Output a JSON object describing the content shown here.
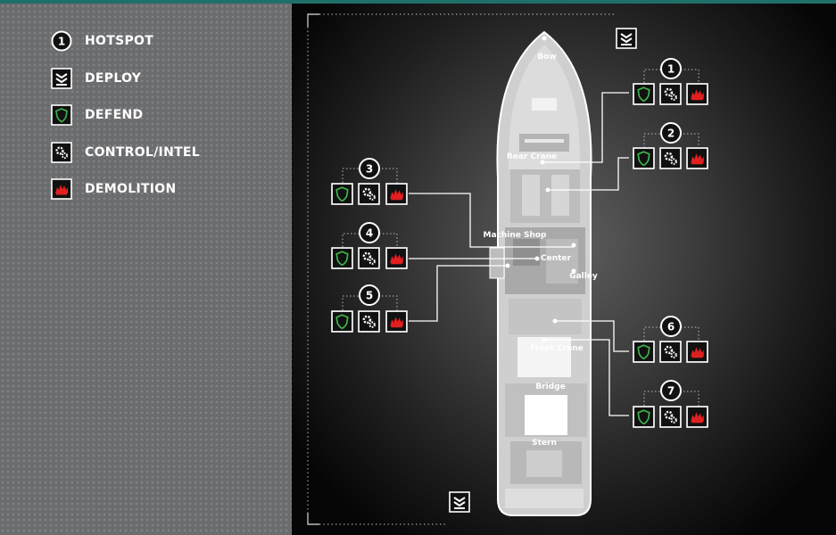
{
  "legend": {
    "items": [
      {
        "icon": "hotspot-icon",
        "label": "HOTSPOT",
        "number": "1"
      },
      {
        "icon": "deploy-icon",
        "label": "DEPLOY"
      },
      {
        "icon": "defend-icon",
        "label": "DEFEND"
      },
      {
        "icon": "control-intel-icon",
        "label": "CONTROL/INTEL"
      },
      {
        "icon": "demolition-icon",
        "label": "DEMOLITION"
      }
    ]
  },
  "ship": {
    "labels": {
      "bow": "Bow",
      "rear_crane": "Rear Crane",
      "machine_shop": "Machine Shop",
      "center": "Center",
      "galley": "Galley",
      "front_crane": "Front Crane",
      "bridge": "Bridge",
      "stern": "Stern"
    }
  },
  "hotspots": [
    {
      "number": "1"
    },
    {
      "number": "2"
    },
    {
      "number": "3"
    },
    {
      "number": "4"
    },
    {
      "number": "5"
    },
    {
      "number": "6"
    },
    {
      "number": "7"
    }
  ],
  "colors": {
    "defend": "#3fb44a",
    "control": "#ffffff",
    "demolition": "#e02020",
    "accent_bar": "#1f6f6a"
  }
}
